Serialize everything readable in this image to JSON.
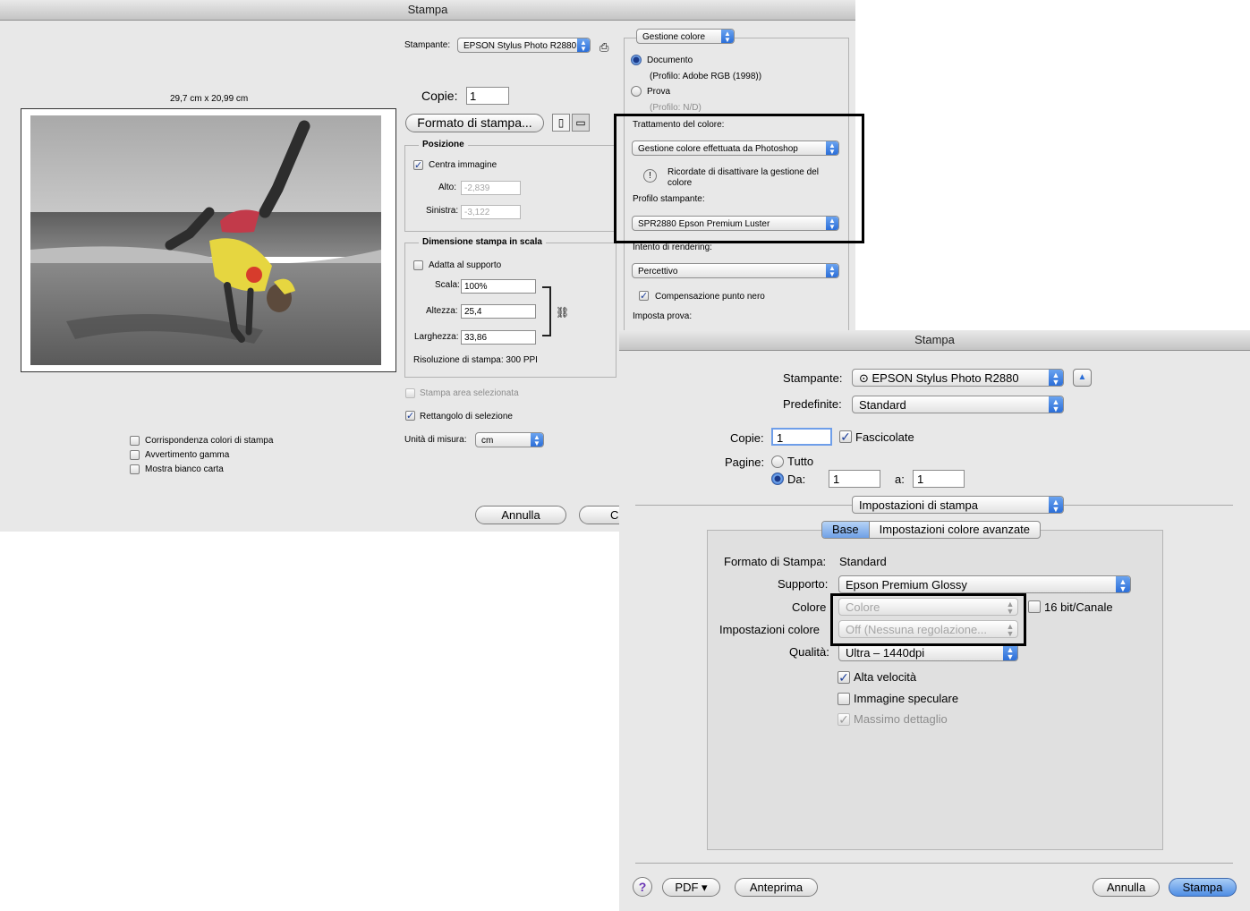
{
  "photoshop_dialog": {
    "title": "Stampa",
    "printer_label": "Stampante:",
    "printer_value": "EPSON Stylus Photo R2880",
    "copies_label": "Copie:",
    "copies_value": "1",
    "page_setup_button": "Formato di stampa...",
    "paper_size": "29,7 cm x 20,99 cm",
    "position": {
      "group_label": "Posizione",
      "center_image": "Centra immagine",
      "top_label": "Alto:",
      "top_value": "-2,839",
      "left_label": "Sinistra:",
      "left_value": "-3,122"
    },
    "scaled_print_size": {
      "group_label": "Dimensione stampa in scala",
      "fit_media": "Adatta al supporto",
      "scale_label": "Scala:",
      "scale_value": "100%",
      "height_label": "Altezza:",
      "height_value": "25,4",
      "width_label": "Larghezza:",
      "width_value": "33,86",
      "resolution": "Risoluzione di stampa: 300 PPI"
    },
    "print_selected_area": "Stampa area selezionata",
    "bounding_box": "Rettangolo di selezione",
    "units_label": "Unità di misura:",
    "units_value": "cm",
    "match_print_colors": "Corrispondenza colori di stampa",
    "gamut_warning": "Avvertimento gamma",
    "show_paper_white": "Mostra bianco carta",
    "cancel_button": "Annulla",
    "print_button_partial": "C",
    "color_panel": {
      "section_popup": "Gestione colore",
      "document_label": "Documento",
      "document_profile": "(Profilo: Adobe RGB (1998))",
      "proof_label": "Prova",
      "proof_profile": "(Profilo: N/D)",
      "color_handling_label": "Trattamento del colore:",
      "color_handling_value": "Gestione colore effettuata da Photoshop",
      "warning_text": "Ricordate di disattivare la gestione del colore",
      "printer_profile_label": "Profilo stampante:",
      "printer_profile_value": "SPR2880 Epson Premium Luster",
      "rendering_intent_label": "Intento di rendering:",
      "rendering_intent_value": "Percettivo",
      "black_point": "Compensazione punto nero",
      "proof_setup_label": "Imposta prova:"
    }
  },
  "os_dialog": {
    "title": "Stampa",
    "printer_label": "Stampante:",
    "printer_value": "EPSON Stylus Photo R2880",
    "presets_label": "Predefinite:",
    "presets_value": "Standard",
    "copies_label": "Copie:",
    "copies_value": "1",
    "collated": "Fascicolate",
    "pages_label": "Pagine:",
    "all_label": "Tutto",
    "from_label": "Da:",
    "from_value": "1",
    "to_label": "a:",
    "to_value": "1",
    "section_popup": "Impostazioni di stampa",
    "tabs": [
      "Base",
      "Impostazioni colore avanzate"
    ],
    "page_setup_label": "Formato di Stampa:",
    "page_setup_value": "Standard",
    "media_label": "Supporto:",
    "media_value": "Epson Premium Glossy",
    "color_label": "Colore",
    "color_value": "Colore",
    "bit_label": "16 bit/Canale",
    "color_settings_label": "Impostazioni colore",
    "color_settings_value": "Off (Nessuna regolazione...",
    "quality_label": "Qualità:",
    "quality_value": "Ultra – 1440dpi",
    "high_speed": "Alta velocità",
    "mirror_image": "Immagine speculare",
    "finest_detail": "Massimo dettaglio",
    "help": "?",
    "pdf_button": "PDF ▾",
    "preview_button": "Anteprima",
    "cancel_button": "Annulla",
    "print_button": "Stampa"
  }
}
